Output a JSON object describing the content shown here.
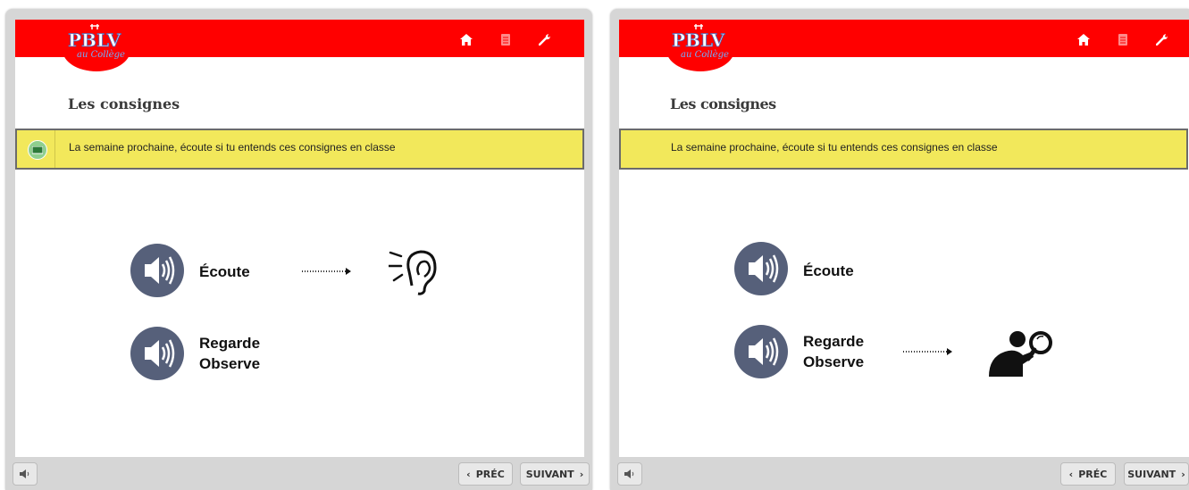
{
  "panels": [
    {
      "logo": {
        "text": "PBLV",
        "script": "au Collège"
      },
      "title": "Les consignes",
      "banner_text": "La semaine prochaine, écoute si tu entends ces consignes en classe",
      "items": [
        {
          "label": "Écoute"
        },
        {
          "label_line1": "Regarde",
          "label_line2": "Observe"
        }
      ],
      "footer": {
        "prev": "PRÉC",
        "next": "SUIVANT"
      }
    },
    {
      "logo": {
        "text": "PBLV",
        "script": "au Collège"
      },
      "title": "Les consignes",
      "banner_text": "La semaine prochaine, écoute si tu entends ces consignes en classe",
      "items": [
        {
          "label": "Écoute"
        },
        {
          "label_line1": "Regarde",
          "label_line2": "Observe"
        }
      ],
      "footer": {
        "prev": "PRÉC",
        "next": "SUIVANT"
      }
    }
  ],
  "icons": {
    "home": "home-icon",
    "document": "document-icon",
    "tools": "wrench-icon",
    "speaker": "speaker-icon",
    "ear": "ear-listening-icon",
    "observer": "magnifying-glass-observer-icon",
    "sound": "volume-icon"
  },
  "colors": {
    "header_red": "#ff0000",
    "banner_yellow": "#f2e85b",
    "speaker_slate": "#56607a"
  }
}
